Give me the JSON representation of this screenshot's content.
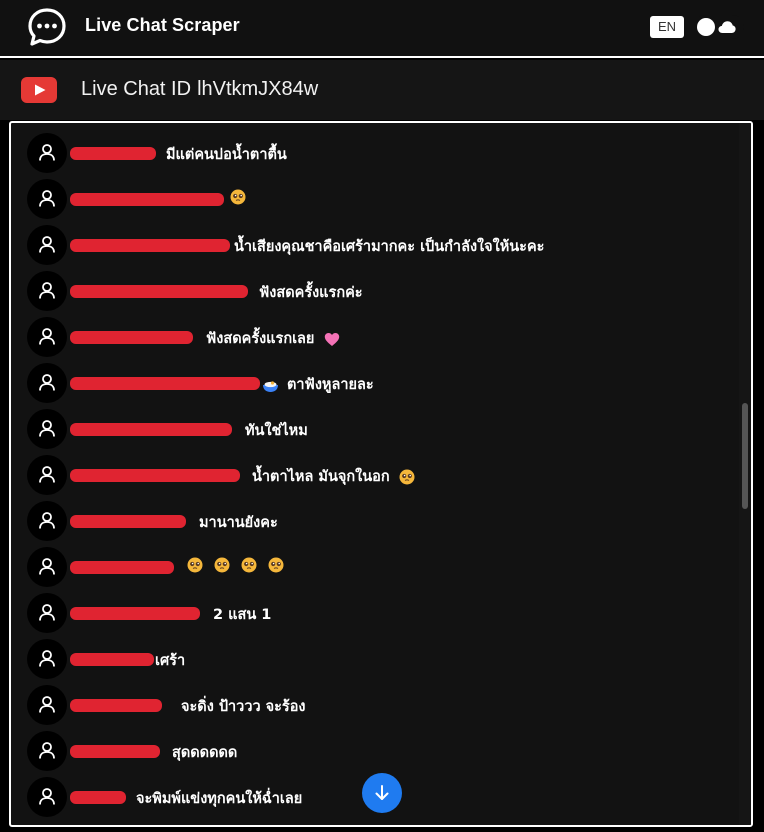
{
  "app": {
    "title": "Live Chat Scraper",
    "lang": "EN",
    "accent": "#1f7bf0",
    "redaction_color": "#e02431"
  },
  "chat": {
    "label": "Live Chat ID",
    "id": "lhVtkmJX84w",
    "messages": [
      {
        "text": "มีแต่คนบ่อน้ำตาตื้น",
        "emojis": []
      },
      {
        "text": "",
        "emojis": [
          "pleading"
        ]
      },
      {
        "text": "น้ำเสียงคุณชาคือเศร้ามากคะ เป็นกำลังใจให้นะคะ",
        "emojis": []
      },
      {
        "text": "ฟังสดครั้งแรกค่ะ",
        "emojis": []
      },
      {
        "text": "ฟังสดครั้งแรกเลย",
        "emojis": [
          "pink-heart"
        ]
      },
      {
        "text": "ตาฟังหูลายละ",
        "emojis": []
      },
      {
        "text": "ทันใช่ไหม",
        "emojis": []
      },
      {
        "text": "น้ำตาไหล มันจุกในอก",
        "emojis": [
          "pleading"
        ]
      },
      {
        "text": "มานานยังคะ",
        "emojis": []
      },
      {
        "text": "",
        "emojis": [
          "pleading",
          "pleading",
          "pleading",
          "pleading"
        ]
      },
      {
        "text": "2 แสน 1",
        "emojis": []
      },
      {
        "text": "เศร้า",
        "emojis": []
      },
      {
        "text": "จะดิ่ง ป้าววว จะร้อง",
        "emojis": []
      },
      {
        "text": "สุดดดดดด",
        "emojis": []
      },
      {
        "text": "จะพิมพ์แข่งทุกคนให้ฉ่ำเลย",
        "emojis": []
      }
    ]
  },
  "icons": {
    "logo": "chat-bubble-dots-icon",
    "theme": "cloud-icon",
    "youtube": "youtube-icon",
    "avatar": "user-icon",
    "scroll_down": "arrow-down-icon"
  }
}
